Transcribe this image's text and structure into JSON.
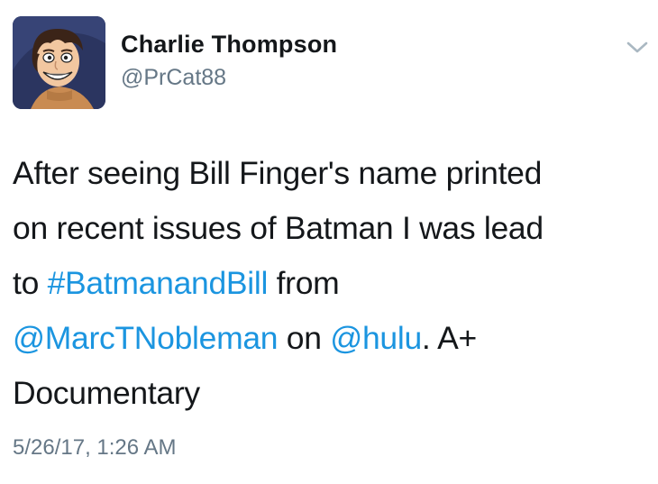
{
  "user": {
    "display_name": "Charlie Thompson",
    "handle": "@PrCat88"
  },
  "menu": {
    "icon": "chevron-down-icon"
  },
  "tweet": {
    "line1": "After seeing Bill Finger's name printed",
    "line2": "on recent issues of Batman I was lead",
    "line3_prefix": "to ",
    "hashtag": "#BatmanandBill",
    "line3_suffix": " from",
    "mention1": "@MarcTNobleman",
    "line4_mid": " on ",
    "mention2": "@hulu",
    "line4_suffix": ". A+",
    "line5": "Documentary"
  },
  "timestamp": "5/26/17, 1:26 AM",
  "colors": {
    "link": "#1b95e0",
    "secondary_text": "#657786",
    "primary_text": "#14171a"
  }
}
